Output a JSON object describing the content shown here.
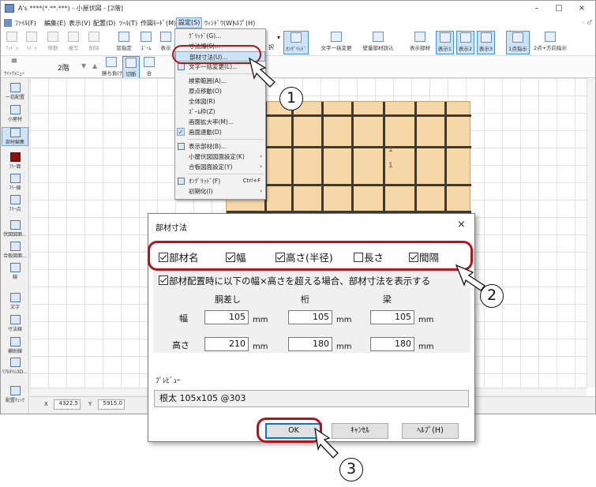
{
  "window": {
    "title": "A's ****(*.**.***) - 小屋伏図 - [2階]",
    "minimize": "–",
    "maximize": "□",
    "close": "×"
  },
  "menubar": {
    "items": [
      "ﾌｧｲﾙ(F)",
      "編集(E)",
      "表示(V)",
      "配置(D)",
      "ﾂｰﾙ(T)",
      "作図ﾓｰﾄﾞ(M)",
      "設定(S)",
      "ｳｨﾝﾄﾞｳ(W)",
      "ﾍﾙﾌﾟ(H)"
    ]
  },
  "toolbar": {
    "left_buttons": [
      "ｱﾝﾄﾞｩ",
      "ﾘﾄﾞｩ",
      "移動",
      "複写",
      "削除",
      "窓指定",
      "ｽﾞｰﾑ",
      "表示"
    ],
    "right_buttons": [
      "ｵﾝｸﾞﾘｯﾄﾞ",
      "文字一括変更",
      "壁量部材読込",
      "表示部材",
      "表示1",
      "表示2",
      "表示3",
      "1点指示",
      "2点+方向指示"
    ],
    "partial_right": "択"
  },
  "toolbar2": {
    "menu_label": "ｸｲｯｸﾒﾆｭｰ",
    "floor": "2階",
    "buttons": [
      "勝ち負け",
      "切断",
      "合"
    ]
  },
  "sidebar": {
    "items": [
      "一括配置",
      "小屋材",
      "部材編集",
      "ﾌﾘｰ面",
      "ﾌﾘｰ線",
      "ﾌﾘｰ点",
      "伏図図面...",
      "合板図面...",
      "線",
      "文字",
      "寸法線",
      "補助線",
      "ﾘｱﾙﾀｲﾑ3D...",
      "配置ﾁｪｯｸ"
    ]
  },
  "status": {
    "x_label": "X",
    "x_value": "4322.5",
    "y_label": "Y",
    "y_value": "5915.0"
  },
  "plan_labels": [
    "1",
    "1"
  ],
  "dropdown": {
    "items": [
      {
        "label": "ｸﾞﾘｯﾄﾞ(G)..."
      },
      {
        "label": "寸法線(S)..."
      },
      {
        "label": "部材寸法(U)..."
      },
      {
        "label": "文字一括変更(L)..."
      },
      {
        "label": "検索範囲(A)..."
      },
      {
        "label": "原点移動(O)"
      },
      {
        "label": "全体図(R)"
      },
      {
        "label": "ｽﾞｰﾑ枠(Z)"
      },
      {
        "label": "画面拡大率(M)..."
      },
      {
        "label": "画面連動(D)"
      },
      {
        "label": "表示部材(B)..."
      },
      {
        "label": "小屋伏図図面設定(K)"
      },
      {
        "label": "合板図面設定(Y)"
      },
      {
        "label": "ｵﾝｸﾞﾘｯﾄﾞ(F)",
        "shortcut": "Ctrl+F"
      },
      {
        "label": "初期化(I)"
      }
    ]
  },
  "dialog": {
    "title": "部材寸法",
    "close": "×",
    "options": {
      "name": {
        "label": "部材名",
        "checked": true
      },
      "width": {
        "label": "幅",
        "checked": true
      },
      "height": {
        "label": "高さ(半径)",
        "checked": true
      },
      "length": {
        "label": "長さ",
        "checked": false
      },
      "spacing": {
        "label": "間隔",
        "checked": true
      }
    },
    "threshold": {
      "label": "部材配置時に以下の幅×高さを超える場合、部材寸法を表示する",
      "checked": true
    },
    "columns": [
      "胴差し",
      "桁",
      "梁"
    ],
    "rows": {
      "width_label": "幅",
      "height_label": "高さ",
      "width_values": [
        "105",
        "105",
        "105"
      ],
      "height_values": [
        "210",
        "180",
        "180"
      ]
    },
    "unit": "mm",
    "preview_label": "ﾌﾟﾚﾋﾞｭｰ",
    "preview_text": "根太 105x105 @303",
    "buttons": {
      "ok": "OK",
      "cancel": "ｷｬﾝｾﾙ",
      "help": "ﾍﾙﾌﾟ(H)"
    }
  },
  "callouts": [
    "1",
    "2",
    "3"
  ],
  "colors": {
    "highlight": "#b5121b",
    "accent": "#0078d7",
    "plan_fill": "#f6d7a8"
  }
}
